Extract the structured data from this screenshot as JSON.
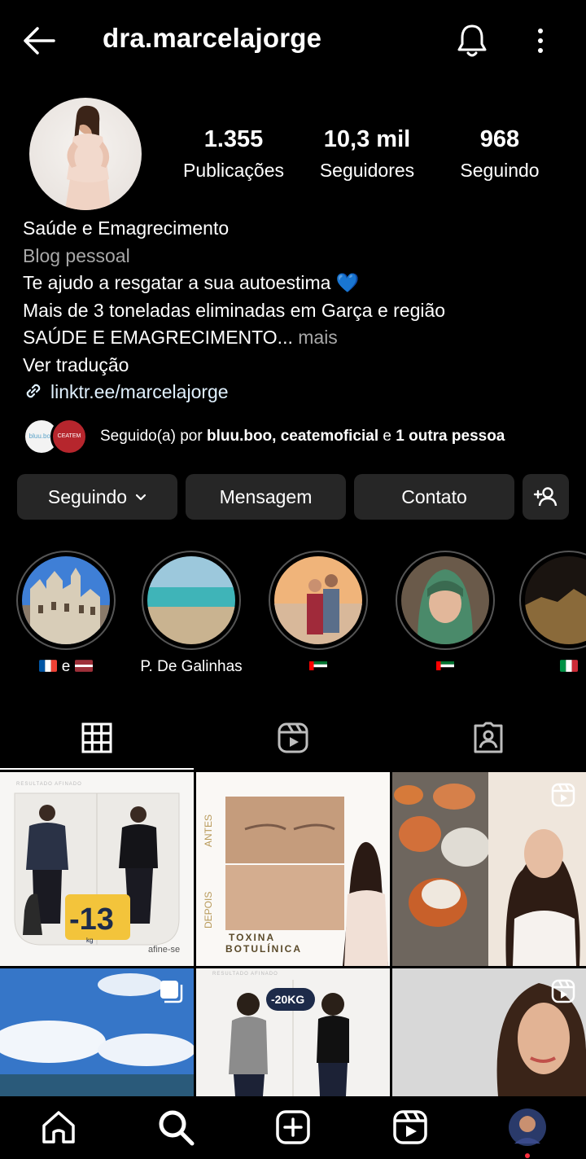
{
  "header": {
    "username": "dra.marcelajorge"
  },
  "stats": [
    {
      "value": "1.355",
      "label": "Publicações"
    },
    {
      "value": "10,3 mil",
      "label": "Seguidores"
    },
    {
      "value": "968",
      "label": "Seguindo"
    }
  ],
  "bio": {
    "name": "Saúde e Emagrecimento",
    "category": "Blog pessoal",
    "line1": "Te ajudo a resgatar a sua autoestima 💙",
    "line2": "Mais de 3 toneladas eliminadas em Garça e região",
    "line3": "SAÚDE E EMAGRECIMENTO...",
    "more": " mais",
    "translate": "Ver tradução",
    "link": "linktr.ee/marcelajorge"
  },
  "followed_by": {
    "prefix": "Seguido(a) por ",
    "user1": "bluu.boo",
    "sep": ", ",
    "user2": "ceatemoficial",
    "and": " e ",
    "others": "1 outra pessoa",
    "avatar1_text": "bluu.boo",
    "avatar2_text": "CEATEM"
  },
  "buttons": {
    "following": "Seguindo",
    "message": "Mensagem",
    "contact": "Contato"
  },
  "highlights": [
    {
      "label": " e ",
      "flags": [
        "france",
        "latvia"
      ]
    },
    {
      "label": "P. De Galinhas"
    },
    {
      "label": "",
      "flags": [
        "uae"
      ]
    },
    {
      "label": "",
      "flags": [
        "uae"
      ]
    },
    {
      "label": "",
      "flags": [
        "italy"
      ]
    }
  ],
  "posts": {
    "p1": {
      "top_text": "RESULTADO AFINADO",
      "badge": "-13",
      "unit": "kg",
      "brand": "afine-se"
    },
    "p2": {
      "before": "ANTES",
      "after": "DEPOIS",
      "title1": "TOXINA",
      "title2": "BOTULÍNICA"
    },
    "p5": {
      "top_text": "RESULTADO AFINADO",
      "badge": "-20KG"
    }
  },
  "colors": {
    "background": "#000000",
    "button": "#262626",
    "muted": "#a8a8a8",
    "notification": "#ff3040"
  }
}
